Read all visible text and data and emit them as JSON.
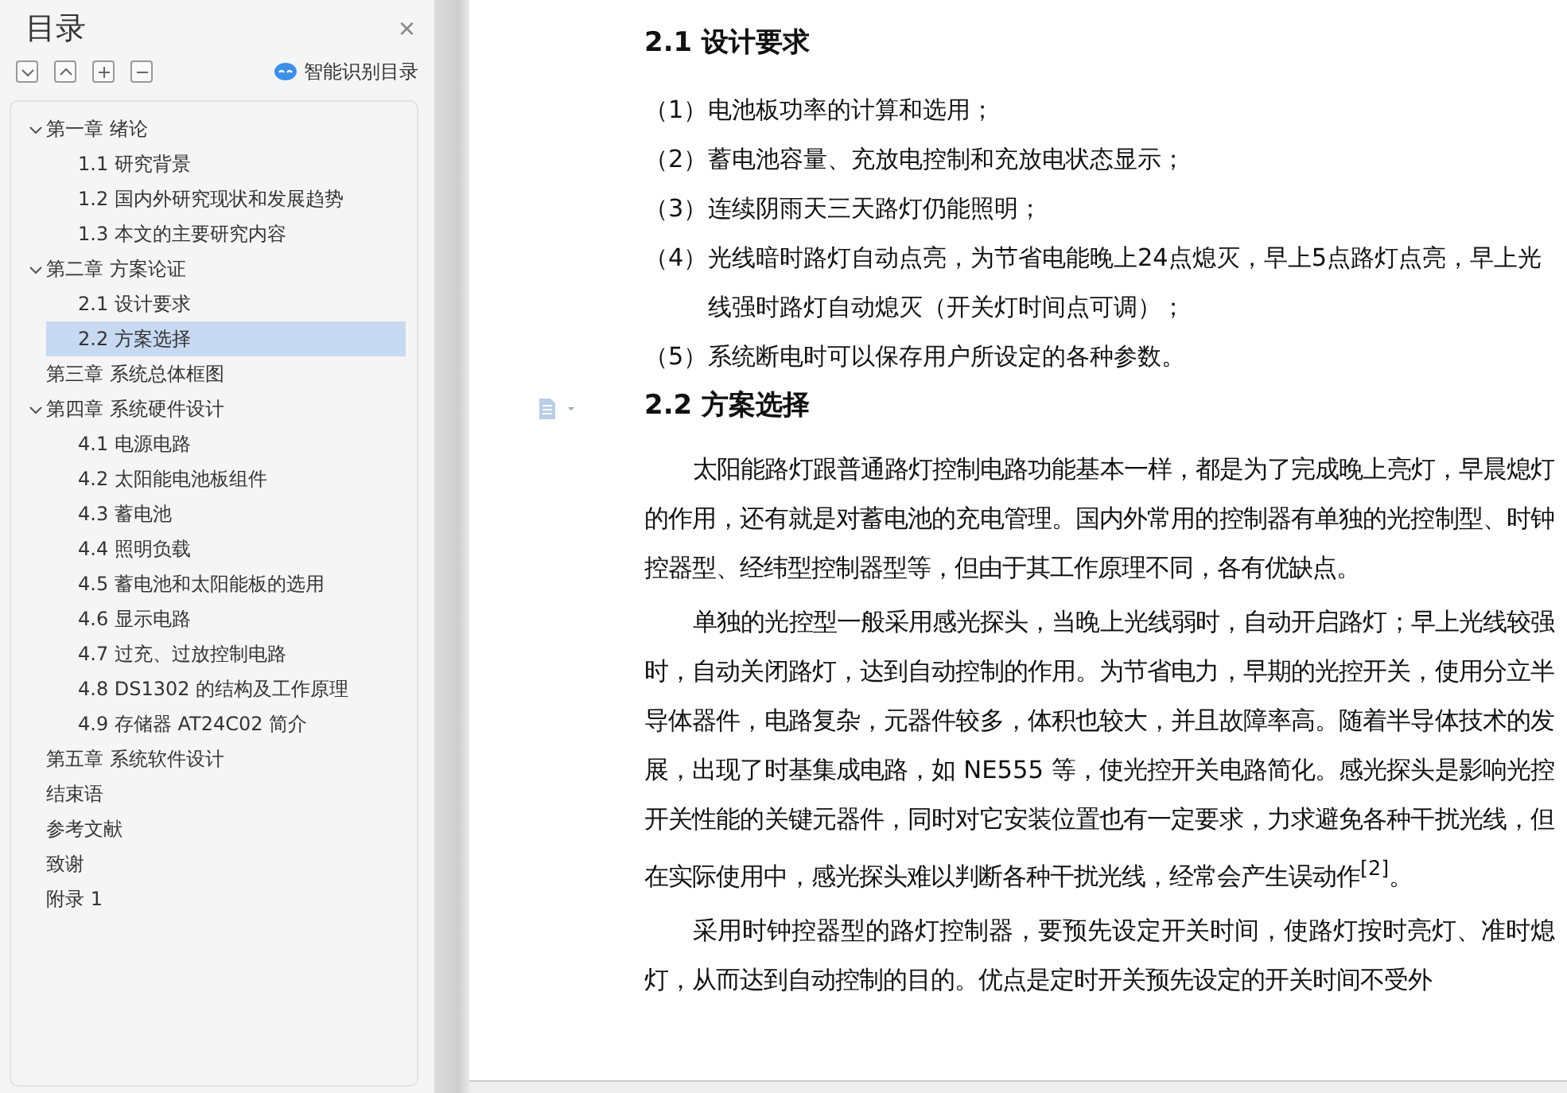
{
  "sidebar": {
    "title": "目录",
    "close": "×",
    "toolbar": [
      {
        "kind": "collapse"
      },
      {
        "kind": "expand"
      },
      {
        "kind": "add"
      },
      {
        "kind": "remove"
      }
    ],
    "smart_button": "智能识别目录",
    "tree": [
      {
        "label": "第一章  绪论",
        "expanded": true,
        "selected": false,
        "children": [
          {
            "label": "1.1 研究背景",
            "selected": false
          },
          {
            "label": "1.2 国内外研究现状和发展趋势",
            "selected": false
          },
          {
            "label": "1.3 本文的主要研究内容",
            "selected": false
          }
        ]
      },
      {
        "label": "第二章  方案论证",
        "expanded": true,
        "selected": false,
        "children": [
          {
            "label": "2.1  设计要求",
            "selected": false
          },
          {
            "label": "2.2  方案选择",
            "selected": true
          }
        ]
      },
      {
        "label": "第三章  系统总体框图",
        "selected": false
      },
      {
        "label": "第四章  系统硬件设计",
        "expanded": true,
        "selected": false,
        "children": [
          {
            "label": "4.1  电源电路",
            "selected": false
          },
          {
            "label": "4.2  太阳能电池板组件",
            "selected": false
          },
          {
            "label": "4.3  蓄电池",
            "selected": false
          },
          {
            "label": "4.4  照明负载",
            "selected": false
          },
          {
            "label": "4.5  蓄电池和太阳能板的选用",
            "selected": false
          },
          {
            "label": "4.6  显示电路",
            "selected": false
          },
          {
            "label": "4.7  过充、过放控制电路",
            "selected": false
          },
          {
            "label": "4.8 DS1302 的结构及工作原理",
            "selected": false
          },
          {
            "label": "4.9  存储器 AT24C02 简介",
            "selected": false
          }
        ]
      },
      {
        "label": "第五章  系统软件设计",
        "selected": false
      },
      {
        "label": "结束语",
        "selected": false
      },
      {
        "label": "参考文献",
        "selected": false
      },
      {
        "label": "致谢",
        "selected": false
      },
      {
        "label": "附录 1",
        "selected": false
      }
    ]
  },
  "document": {
    "blocks": [
      {
        "kind": "heading",
        "text": "2.1  设计要求"
      },
      {
        "kind": "list_item",
        "number": "（1）",
        "text": "电池板功率的计算和选用；"
      },
      {
        "kind": "list_item",
        "number": "（2）",
        "text": "蓄电池容量、充放电控制和充放电状态显示；"
      },
      {
        "kind": "list_item",
        "number": "（3）",
        "text": "连续阴雨天三天路灯仍能照明；"
      },
      {
        "kind": "list_item",
        "number": "（4）",
        "text": "光线暗时路灯自动点亮，为节省电能晚上24点熄灭，早上5点路灯点亮，早上光线强时路灯自动熄灭（开关灯时间点可调）；"
      },
      {
        "kind": "list_item",
        "number": "（5）",
        "text": "系统断电时可以保存用户所设定的各种参数。"
      },
      {
        "kind": "heading",
        "text": "2.2  方案选择",
        "marker": true
      },
      {
        "kind": "paragraph",
        "text": "太阳能路灯跟普通路灯控制电路功能基本一样，都是为了完成晚上亮灯，早晨熄灯的作用，还有就是对蓄电池的充电管理。国内外常用的控制器有单独的光控制型、时钟控器型、经纬型控制器型等，但由于其工作原理不同，各有优缺点。"
      },
      {
        "kind": "paragraph",
        "text": "单独的光控型一般采用感光探头，当晚上光线弱时，自动开启路灯；早上光线较强时，自动关闭路灯，达到自动控制的作用。为节省电力，早期的光控开关，使用分立半导体器件，电路复杂，元器件较多，体积也较大，并且故障率高。随着半导体技术的发展，出现了时基集成电路，如 NE555 等，使光控开关电路简化。感光探头是影响光控开关性能的关键元器件，同时对它安装位置也有一定要求，力求避免各种干扰光线，但在实际使用中，感光探头难以判断各种干扰光线，经常会产生误动作$^{[2]}$。"
      },
      {
        "kind": "paragraph",
        "text": "采用时钟控器型的路灯控制器，要预先设定开关时间，使路灯按时亮灯、准时熄灯，从而达到自动控制的目的。优点是定时开关预先设定的开关时间不受外"
      }
    ]
  }
}
